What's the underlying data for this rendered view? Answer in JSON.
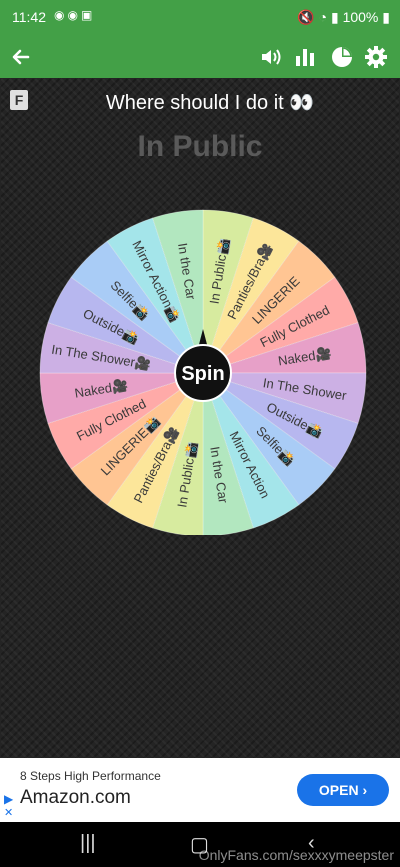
{
  "status": {
    "time": "11:42",
    "battery": "100%"
  },
  "app_bar": {
    "back": "back-arrow-icon"
  },
  "header": {
    "title": "Where should I do it 👀",
    "result": "In Public",
    "badge": "F"
  },
  "wheel": {
    "center_label": "Spin",
    "slices": [
      {
        "label": "In Public📸",
        "color": "#d7eb9f"
      },
      {
        "label": "Panties/Bra🎥",
        "color": "#fce69a"
      },
      {
        "label": "LINGERIE",
        "color": "#ffc593"
      },
      {
        "label": "Fully Clothed",
        "color": "#ffaaa8"
      },
      {
        "label": "Naked🎥",
        "color": "#e7a0c8"
      },
      {
        "label": "In The Shower",
        "color": "#ccb0e4"
      },
      {
        "label": "Outside📸",
        "color": "#b7b7ef"
      },
      {
        "label": "Selfie📸",
        "color": "#a9ccf6"
      },
      {
        "label": "Mirror Action",
        "color": "#a4e5ea"
      },
      {
        "label": "In the Car",
        "color": "#b2e7bf"
      },
      {
        "label": "In Public📸",
        "color": "#d7eb9f"
      },
      {
        "label": "Panties/Bra🎥",
        "color": "#fce69a"
      },
      {
        "label": "LINGERIE📸",
        "color": "#ffc593"
      },
      {
        "label": "Fully Clothed",
        "color": "#ffaaa8"
      },
      {
        "label": "Naked🎥",
        "color": "#e7a0c8"
      },
      {
        "label": "In The Shower🎥",
        "color": "#ccb0e4"
      },
      {
        "label": "Outside📸",
        "color": "#b7b7ef"
      },
      {
        "label": "Selfie📸",
        "color": "#a9ccf6"
      },
      {
        "label": "Mirror Action📸",
        "color": "#a4e5ea"
      },
      {
        "label": "In the Car",
        "color": "#b2e7bf"
      }
    ]
  },
  "ad": {
    "subtitle": "8 Steps High Performance",
    "brand": "Amazon.com",
    "cta": "OPEN ›"
  },
  "watermark": "OnlyFans.com/sexxxymeepster",
  "colors": {
    "app_green": "#43a047",
    "ad_blue": "#1a73e8"
  }
}
